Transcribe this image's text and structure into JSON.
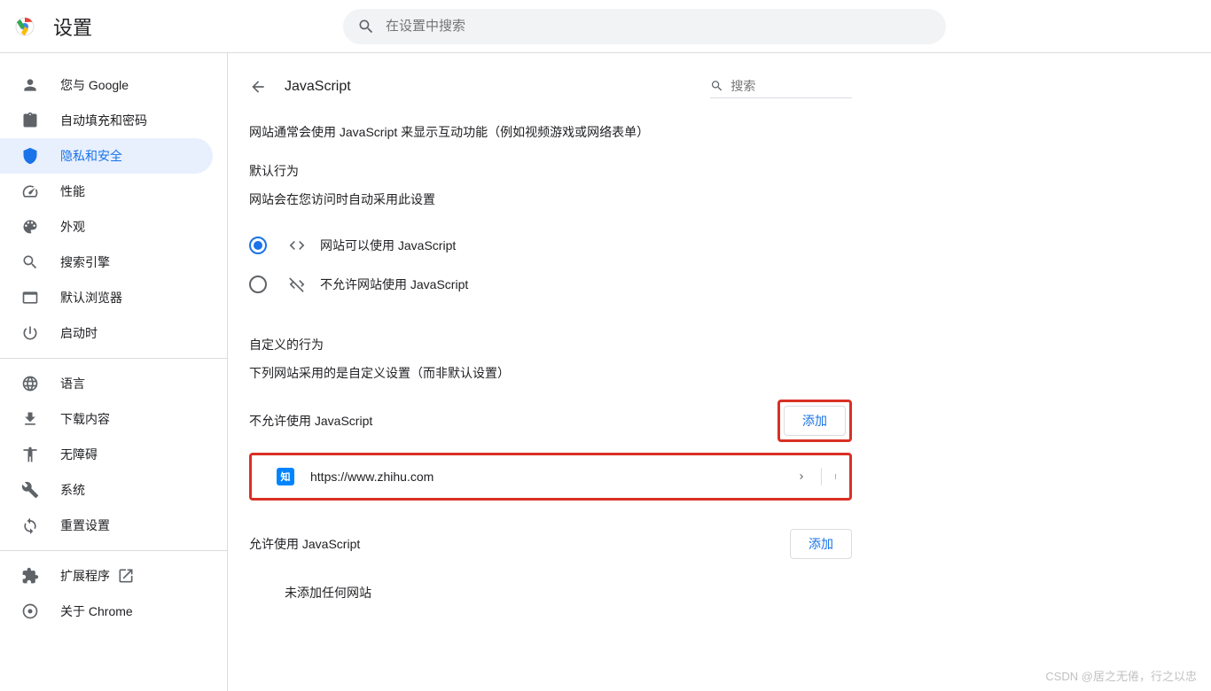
{
  "header": {
    "title": "设置",
    "search_placeholder": "在设置中搜索"
  },
  "sidebar": {
    "groups": [
      [
        {
          "icon": "person",
          "label": "您与 Google"
        },
        {
          "icon": "clipboard",
          "label": "自动填充和密码"
        },
        {
          "icon": "shield",
          "label": "隐私和安全",
          "active": true
        },
        {
          "icon": "speed",
          "label": "性能"
        },
        {
          "icon": "palette",
          "label": "外观"
        },
        {
          "icon": "search",
          "label": "搜索引擎"
        },
        {
          "icon": "browser",
          "label": "默认浏览器"
        },
        {
          "icon": "power",
          "label": "启动时"
        }
      ],
      [
        {
          "icon": "globe",
          "label": "语言"
        },
        {
          "icon": "download",
          "label": "下载内容"
        },
        {
          "icon": "accessibility",
          "label": "无障碍"
        },
        {
          "icon": "wrench",
          "label": "系统"
        },
        {
          "icon": "reset",
          "label": "重置设置"
        }
      ],
      [
        {
          "icon": "puzzle",
          "label": "扩展程序",
          "ext": true
        },
        {
          "icon": "chrome",
          "label": "关于 Chrome"
        }
      ]
    ]
  },
  "page": {
    "title": "JavaScript",
    "search_placeholder": "搜索",
    "description": "网站通常会使用 JavaScript 来显示互动功能（例如视频游戏或网络表单）",
    "default_section": "默认行为",
    "default_sub": "网站会在您访问时自动采用此设置",
    "opt_allow": "网站可以使用 JavaScript",
    "opt_block": "不允许网站使用 JavaScript",
    "custom_section": "自定义的行为",
    "custom_sub": "下列网站采用的是自定义设置（而非默认设置）",
    "block_title": "不允许使用 JavaScript",
    "allow_title": "允许使用 JavaScript",
    "add_btn": "添加",
    "empty": "未添加任何网站",
    "blocked_sites": [
      {
        "favicon": "知",
        "url": "https://www.zhihu.com"
      }
    ]
  },
  "watermark": "CSDN @居之无倦，行之以忠"
}
